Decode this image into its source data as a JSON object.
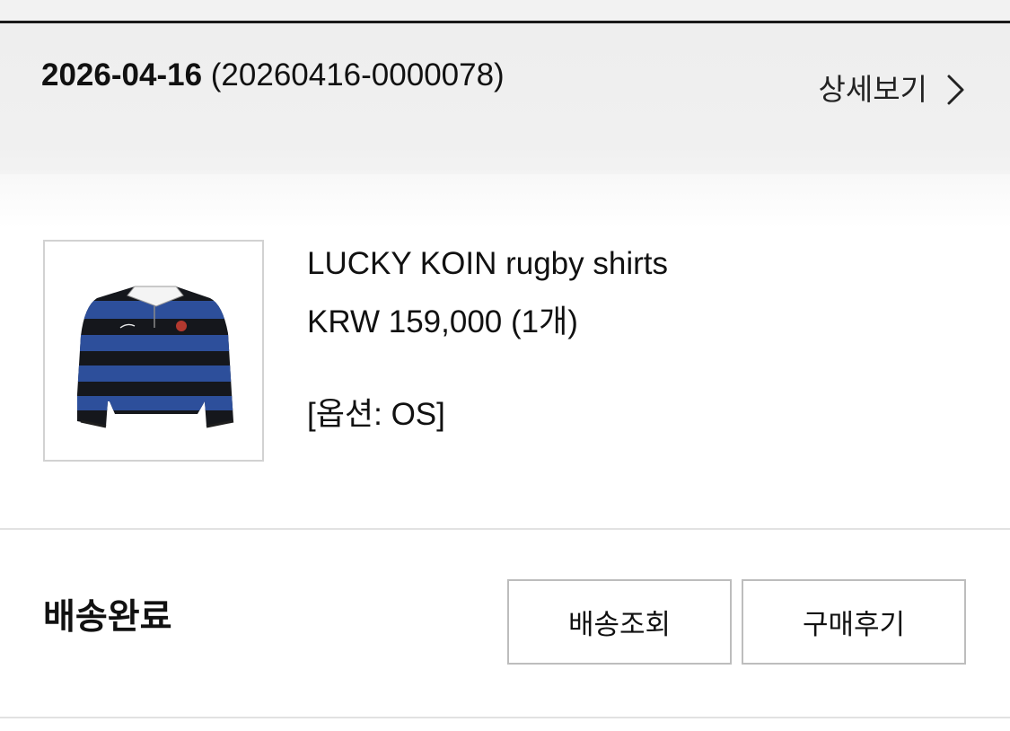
{
  "order": {
    "date": "2026-04-16",
    "number": " (20260416-0000078)",
    "detail_link_label": "상세보기",
    "detail_icon": "chevron-right-icon"
  },
  "product": {
    "name": "LUCKY KOIN rugby shirts",
    "price": "KRW 159,000 (1개)",
    "option": "[옵션: OS]",
    "image_icon": "rugby-shirt-thumbnail",
    "colors": {
      "stripe_blue": "#2d4f9b",
      "stripe_black": "#15171c",
      "collar": "#f4f4f4"
    }
  },
  "delivery": {
    "status": "배송완료",
    "track_button": "배송조회",
    "review_button": "구매후기"
  },
  "colors": {
    "header_bg": "#eeeeee",
    "text": "#111111",
    "button_border": "#bdbdbd",
    "divider": "#e2e2e2"
  }
}
